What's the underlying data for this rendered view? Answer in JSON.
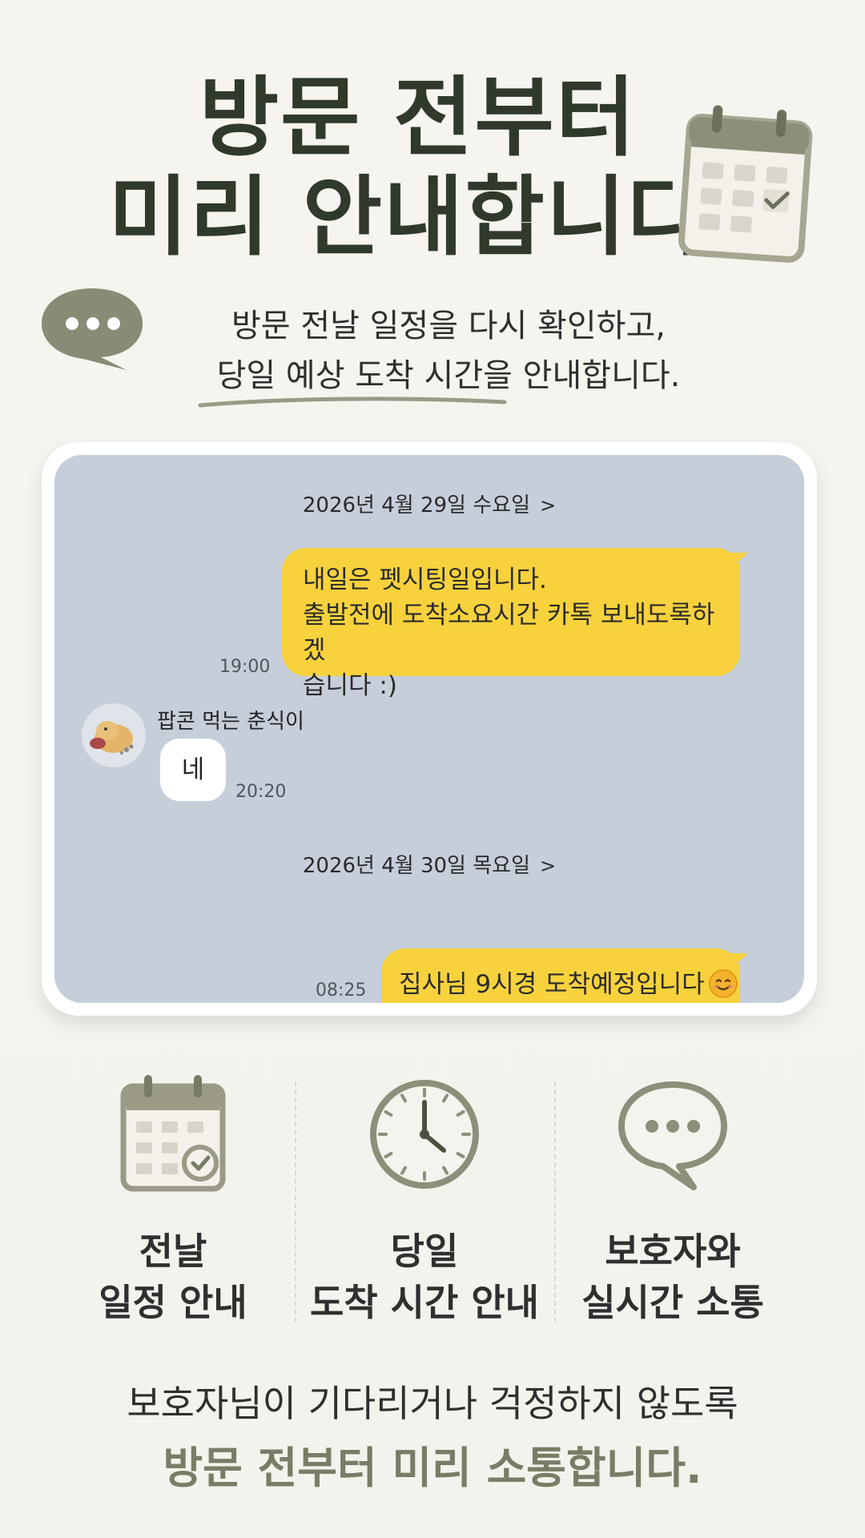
{
  "hero": {
    "title_line1": "방문 전부터",
    "title_line2": "미리 안내합니다",
    "subtitle_line1": "방문 전날 일정을 다시 확인하고,",
    "subtitle_line2": "당일 예상 도착 시간을 안내합니다.",
    "icons": [
      "calendar-icon",
      "speech-bubble-icon"
    ]
  },
  "chat": {
    "date1": "2026년 4월 29일 수요일",
    "date2": "2026년 4월 30일 목요일",
    "chevron": ">",
    "msg1_line1": "내일은 펫시팅일입니다.",
    "msg1_line2": "출발전에 도착소요시간 카톡 보내도록하겠",
    "msg1_line3": "습니다 :)",
    "msg1_time": "19:00",
    "sender_name": "팝콘 먹는 춘식이",
    "reply": "네",
    "reply_time": "20:20",
    "msg2": "집사님 9시경 도착예정입니다",
    "msg2_time": "08:25"
  },
  "features": [
    {
      "icon": "calendar-check-icon",
      "line1": "전날",
      "line2": "일정 안내"
    },
    {
      "icon": "clock-icon",
      "line1": "당일",
      "line2": "도착 시간 안내"
    },
    {
      "icon": "chat-bubble-icon",
      "line1": "보호자와",
      "line2": "실시간 소통"
    }
  ],
  "footer": {
    "line1": "보호자님이 기다리거나 걱정하지 않도록",
    "line2": "방문 전부터 미리 소통합니다."
  },
  "colors": {
    "title": "#2f3a2a",
    "accent": "#7b7c66",
    "kakao_yellow": "#f7d23d",
    "chat_bg": "#c6ceda"
  }
}
